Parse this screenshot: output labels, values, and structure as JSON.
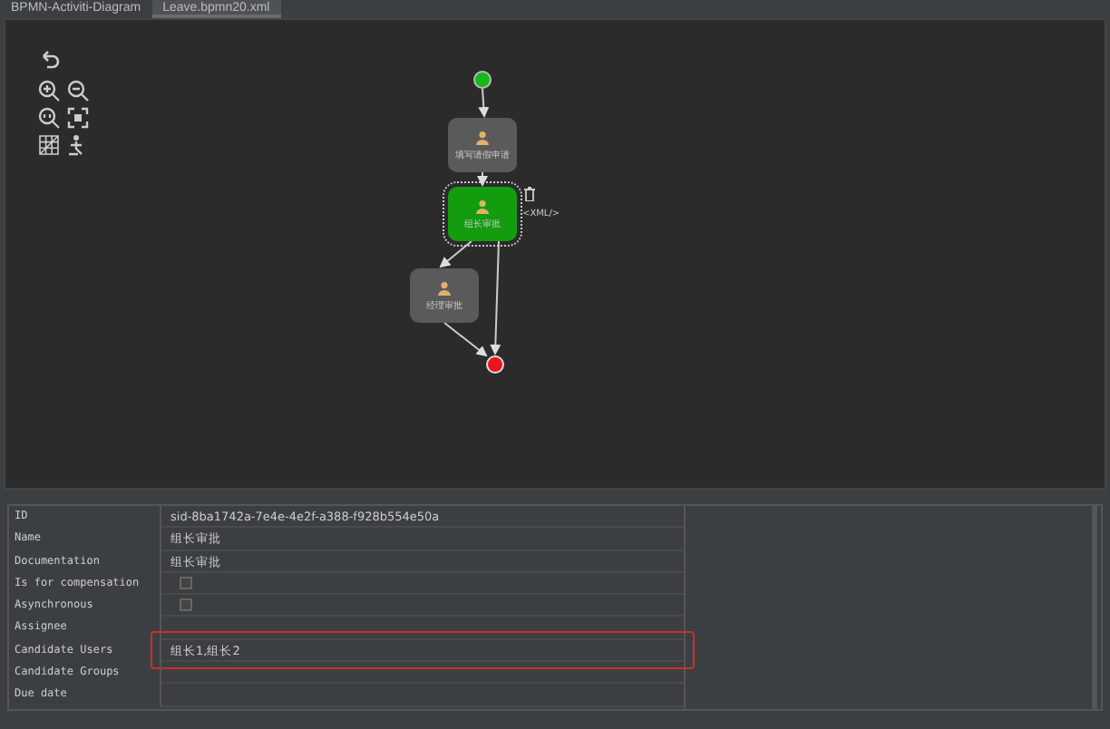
{
  "tabs": [
    {
      "label": "BPMN-Activiti-Diagram",
      "selected": false
    },
    {
      "label": "Leave.bpmn20.xml",
      "selected": true
    }
  ],
  "diagram": {
    "nodes": [
      {
        "kind": "start"
      },
      {
        "kind": "task",
        "label": "填写请假申请",
        "selected": false
      },
      {
        "kind": "task",
        "label": "组长审批",
        "selected": true
      },
      {
        "kind": "task",
        "label": "经理审批",
        "selected": false
      },
      {
        "kind": "end"
      }
    ],
    "selection_label": "<XML/>"
  },
  "properties": [
    {
      "label": "ID",
      "kind": "text",
      "value": "sid-8ba1742a-7e4e-4e2f-a388-f928b554e50a",
      "highlighted": false
    },
    {
      "label": "Name",
      "kind": "text",
      "value": "组长审批",
      "highlighted": false
    },
    {
      "label": "Documentation",
      "kind": "text",
      "value": "组长审批",
      "highlighted": false
    },
    {
      "label": "Is for compensation",
      "kind": "checkbox",
      "checked": false,
      "highlighted": false
    },
    {
      "label": "Asynchronous",
      "kind": "checkbox",
      "checked": false,
      "highlighted": false
    },
    {
      "label": "Assignee",
      "kind": "text",
      "highlighted": false
    },
    {
      "label": "Candidate Users",
      "kind": "text",
      "value": "组长1,组长2",
      "highlighted": true
    },
    {
      "label": "Candidate Groups",
      "kind": "text",
      "highlighted": false
    },
    {
      "label": "Due date",
      "kind": "text",
      "highlighted": false
    }
  ]
}
